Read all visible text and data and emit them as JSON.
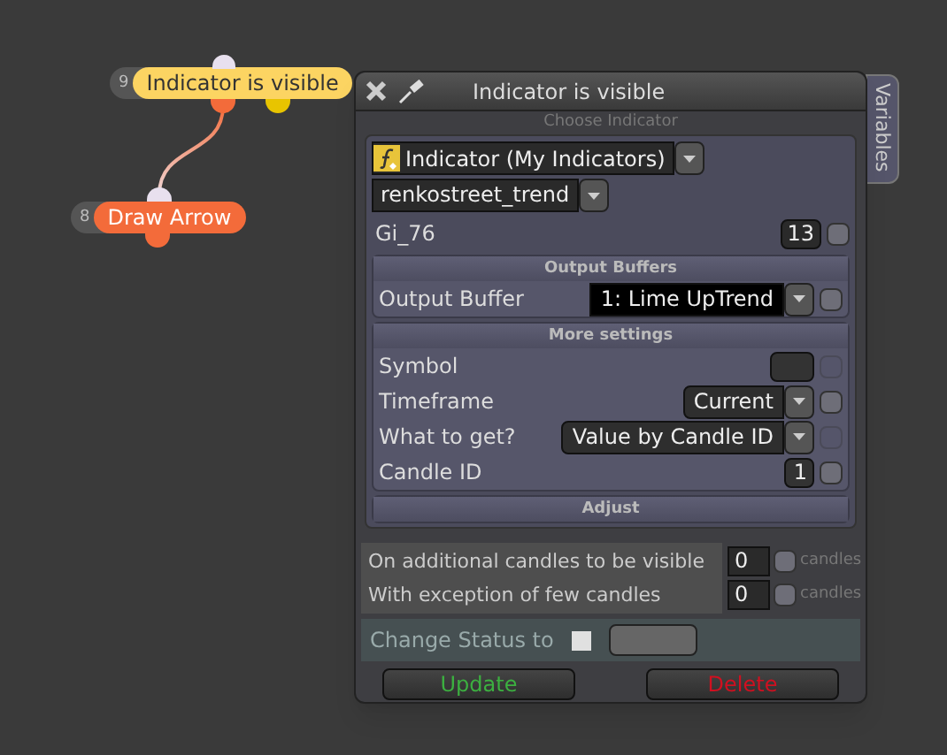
{
  "nodes": [
    {
      "number": "9",
      "label": "Indicator is visible",
      "color": "#fcd462"
    },
    {
      "number": "8",
      "label": "Draw Arrow",
      "color": "#f36b3a"
    }
  ],
  "panel": {
    "title": "Indicator is visible",
    "side_tab": "Variables",
    "section_label": "Choose Indicator",
    "indicator_select": "Indicator (My Indicators)",
    "indicator_name": "renkostreet_trend",
    "parameter": {
      "label": "Gi_76",
      "value": "13",
      "checked": false
    },
    "groups": [
      {
        "title": "Output Buffers",
        "rows": [
          {
            "kind": "select",
            "label": "Output Buffer",
            "value": "1: Lime UpTrend",
            "dark": true,
            "checked": false,
            "disabled": false
          }
        ]
      },
      {
        "title": "More settings",
        "rows": [
          {
            "kind": "input",
            "label": "Symbol",
            "checked": false,
            "disabled": true
          },
          {
            "kind": "select",
            "label": "Timeframe",
            "value": "Current",
            "dark": false,
            "checked": false,
            "disabled": false
          },
          {
            "kind": "select",
            "label": "What to get?",
            "value": "Value by Candle ID",
            "dark": false,
            "checked": false,
            "disabled": true
          },
          {
            "kind": "input",
            "label": "Candle ID",
            "value": "1",
            "checked": false,
            "disabled": false
          }
        ]
      },
      {
        "title": "Adjust"
      }
    ],
    "extra_rows": [
      {
        "label": "On additional candles to be visible",
        "value": "0",
        "unit": "candles",
        "checked": false
      },
      {
        "label": "With exception of few candles",
        "value": "0",
        "unit": "candles",
        "checked": false
      }
    ],
    "status": {
      "label": "Change Status to",
      "checked": false
    },
    "buttons": [
      {
        "label": "Update",
        "kind": "confirm"
      },
      {
        "label": "Delete",
        "kind": "danger"
      }
    ]
  }
}
